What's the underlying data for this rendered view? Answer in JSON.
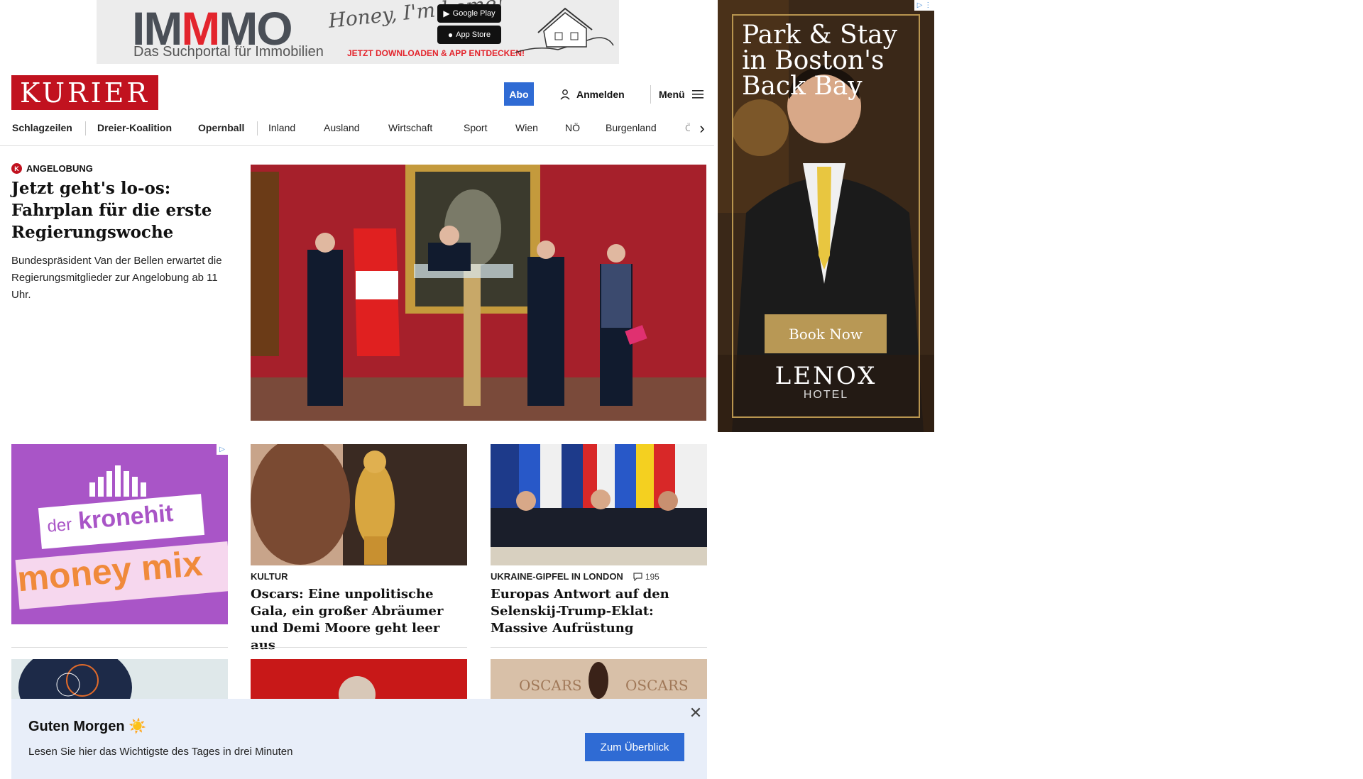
{
  "top_ad": {
    "logo": "IMMMO",
    "tagline": "Das Suchportal für Immobilien",
    "script": "Honey, I'm home!",
    "google_play": "Google Play",
    "app_store": "App Store",
    "cta": "JETZT DOWNLOADEN & APP ENTDECKEN!"
  },
  "header": {
    "logo": "KURIER",
    "abo": "Abo",
    "login": "Anmelden",
    "menu": "Menü"
  },
  "nav": {
    "items": [
      "Schlagzeilen",
      "Dreier-Koalition",
      "Opernball",
      "Inland",
      "Ausland",
      "Wirtschaft",
      "Sport",
      "Wien",
      "NÖ",
      "Burgenland",
      "Ö"
    ]
  },
  "lead": {
    "kicker": "Angelobung",
    "title": "Jetzt geht's lo-os: Fahrplan für die erste Regierungswoche",
    "text": "Bundespräsident Van der Bellen erwartet die Regierungsmitglieder zur Angelobung ab 11 Uhr."
  },
  "side_ad": {
    "title_lines": [
      "Park & Stay",
      "in Boston's",
      "Back Bay"
    ],
    "button": "Book Now",
    "brand": "LENOX",
    "brand_sub": "HOTEL"
  },
  "kronehit_ad": {
    "line1_small": "der",
    "line1": "kronehit",
    "line2": "money mix"
  },
  "cards": [
    {
      "kicker": "Kultur",
      "title": "Oscars: Eine unpolitische Gala, ein großer Abräumer und Demi Moore geht leer aus"
    },
    {
      "kicker": "Ukraine-Gipfel in London",
      "comments": "195",
      "title": "Europas Antwort auf den Selenskij-Trump-Eklat: Massive Aufrüstung"
    }
  ],
  "banner": {
    "title": "Guten Morgen ☀️",
    "text": "Lesen Sie hier das Wichtigste des Tages in drei Minuten",
    "button": "Zum Überblick"
  }
}
